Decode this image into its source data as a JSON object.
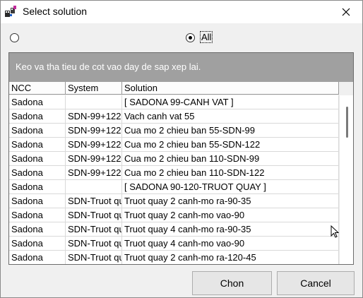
{
  "window": {
    "title": "Select solution",
    "app_icon": "app-icon",
    "close_icon": "close-icon"
  },
  "filter": {
    "all_label": "All",
    "all_selected": true
  },
  "grid": {
    "group_hint": "Keo va tha tieu de cot vao day de sap xep lai.",
    "columns": [
      "NCC",
      "System",
      "Solution"
    ],
    "rows": [
      {
        "ncc": "Sadona",
        "system": "",
        "solution": "[ SADONA 99-CANH VAT ]"
      },
      {
        "ncc": "Sadona",
        "system": "SDN-99+122",
        "solution": "Vach canh vat 55"
      },
      {
        "ncc": "Sadona",
        "system": "SDN-99+122",
        "solution": "Cua mo 2 chieu ban 55-SDN-99"
      },
      {
        "ncc": "Sadona",
        "system": "SDN-99+122",
        "solution": "Cua mo 2 chieu ban 55-SDN-122"
      },
      {
        "ncc": "Sadona",
        "system": "SDN-99+122",
        "solution": "Cua mo 2 chieu ban 110-SDN-99"
      },
      {
        "ncc": "Sadona",
        "system": "SDN-99+122",
        "solution": "Cua mo 2 chieu ban 110-SDN-122"
      },
      {
        "ncc": "Sadona",
        "system": "",
        "solution": "[ SADONA 90-120-TRUOT QUAY ]"
      },
      {
        "ncc": "Sadona",
        "system": "SDN-Truot quay",
        "solution": "Truot quay 2 canh-mo ra-90-35"
      },
      {
        "ncc": "Sadona",
        "system": "SDN-Truot quay",
        "solution": "Truot quay 2 canh-mo vao-90"
      },
      {
        "ncc": "Sadona",
        "system": "SDN-Truot quay",
        "solution": "Truot quay 4 canh-mo ra-90-35"
      },
      {
        "ncc": "Sadona",
        "system": "SDN-Truot quay",
        "solution": "Truot quay 4 canh-mo vao-90"
      },
      {
        "ncc": "Sadona",
        "system": "SDN-Truot quay",
        "solution": "Truot quay 2 canh-mo ra-120-45"
      }
    ]
  },
  "buttons": {
    "ok": "Chon",
    "cancel": "Cancel"
  }
}
